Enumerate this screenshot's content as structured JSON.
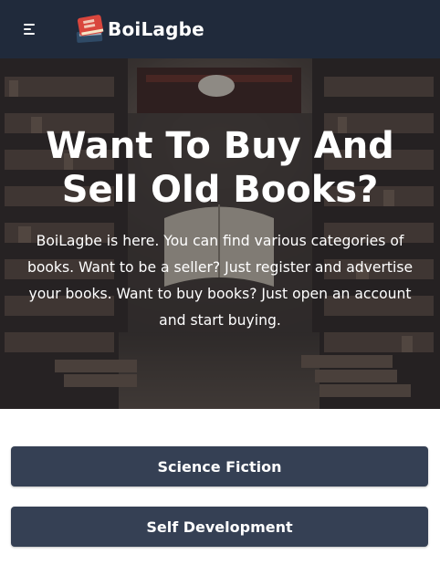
{
  "navbar": {
    "menu_icon": "hamburger-menu-icon",
    "logo_icon": "books-logo-icon",
    "brand_name": "BoiLagbe",
    "background": "#202a3b"
  },
  "hero": {
    "title": "Want To Buy And Sell Old Books?",
    "description": "BoiLagbe is here. You can find various categories of books. Want to be a seller? Just register and advertise your books. Want to buy books? Just open an account and start buying.",
    "background_image": "library-bookshelves-photo"
  },
  "categories": [
    {
      "label": "Science Fiction"
    },
    {
      "label": "Self Development"
    }
  ],
  "colors": {
    "navbar": "#202a3b",
    "button": "#354054",
    "text_light": "#ffffff"
  }
}
